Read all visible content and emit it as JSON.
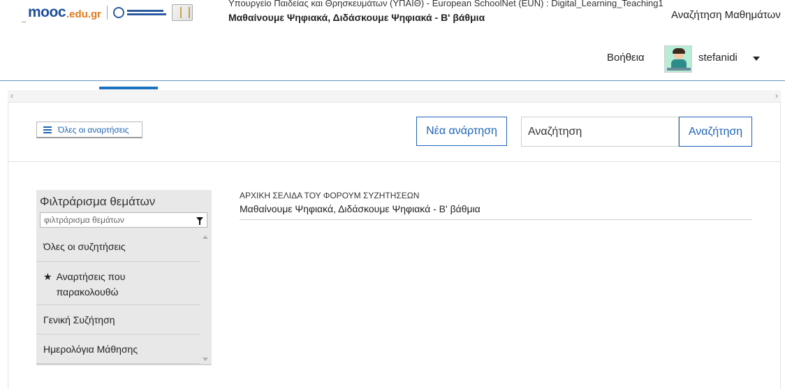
{
  "header": {
    "course_org": "Υπουργείο Παιδείας και Θρησκευμάτων (ΥΠΑΙΘ) - European SchoolNet (EUN) : Digital_Learning_Teaching1",
    "course_title": "Μαθαίνουμε Ψηφιακά, Διδάσκουμε Ψηφιακά - Β' βάθμια",
    "course_search": "Αναζήτηση Μαθημάτων",
    "help": "Βοήθεια",
    "username": "stefanidi",
    "logo": {
      "mooc": "mooc",
      "edu": ".edu.gr"
    }
  },
  "toolbar": {
    "all_posts": "Όλες οι αναρτήσεις",
    "new_post": "Νέα ανάρτηση",
    "search_placeholder": "Αναζήτηση",
    "search_button": "Αναζήτηση"
  },
  "sidebar": {
    "title": "Φιλτράρισμα θεμάτων",
    "filter_placeholder": "φιλτράρισμα θεμάτων",
    "items": [
      {
        "label": "Όλες οι συζητήσεις"
      },
      {
        "label": "Αναρτήσεις που παρακολουθώ",
        "icon": "star-icon"
      },
      {
        "label": "Γενική Συζήτηση"
      },
      {
        "label": "Ημερολόγια Μάθησης"
      }
    ]
  },
  "main": {
    "breadcrumb": "ΑΡΧΙΚΗ ΣΕΛΙΔΑ ΤΟΥ ΦΟΡΟΥΜ ΣΥΖΗΤΗΣΕΩΝ",
    "forum_name": "Μαθαίνουμε Ψηφιακά, Διδάσκουμε Ψηφιακά - Β' βάθμια"
  },
  "colors": {
    "accent": "#1e64b4",
    "header_border": "#6a93c0",
    "sidebar_bg": "#e8e8e8"
  }
}
